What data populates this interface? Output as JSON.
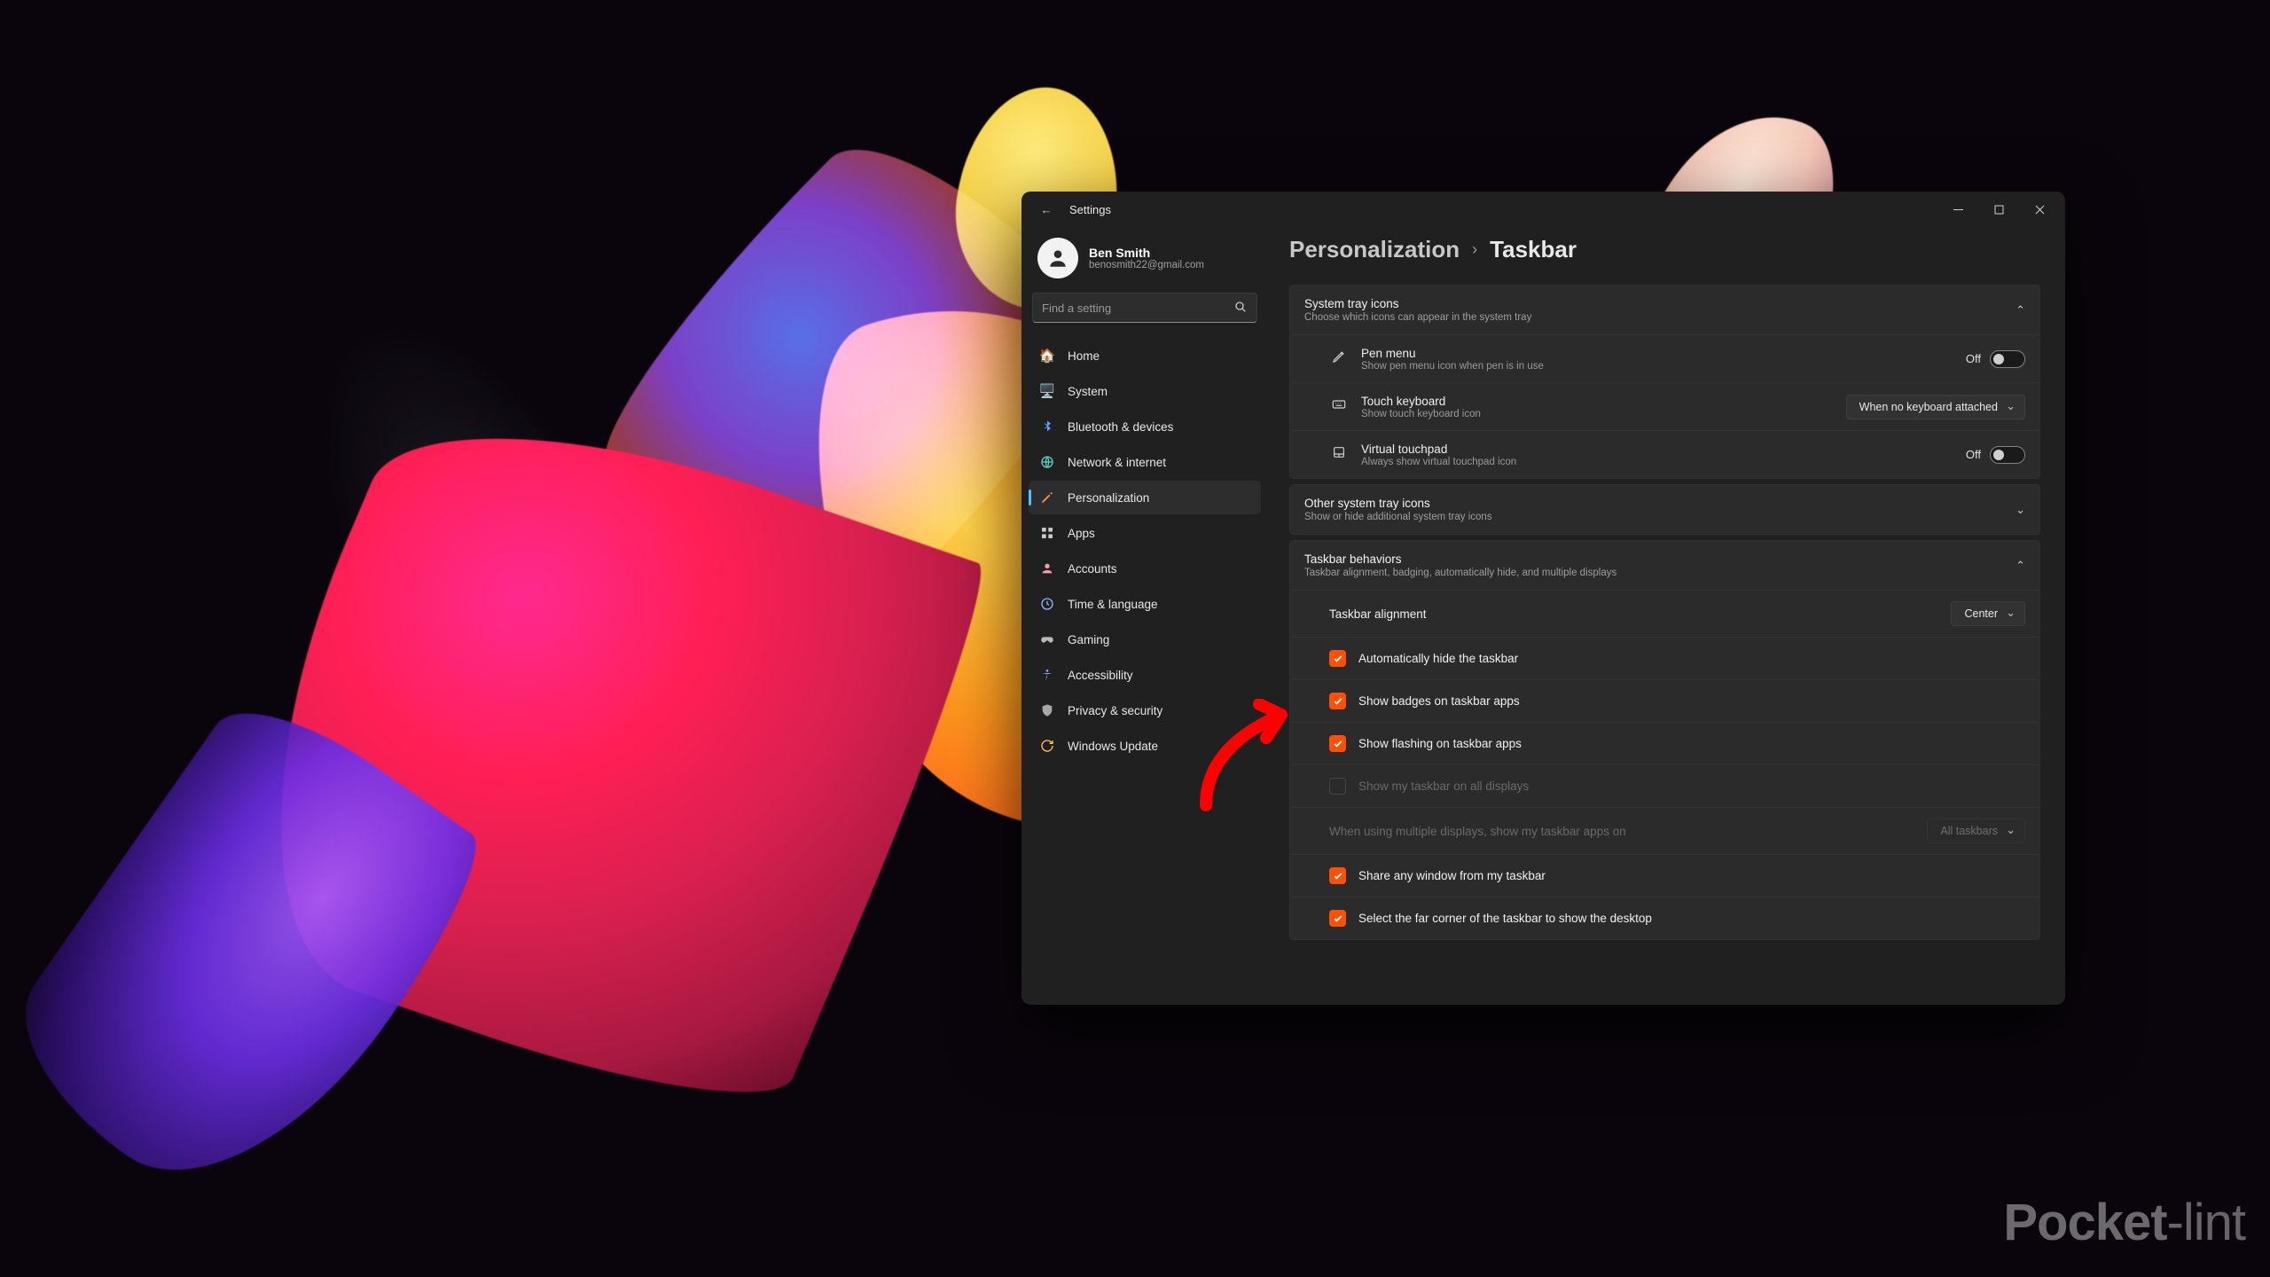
{
  "watermark": "Pocket-lint",
  "window": {
    "title": "Settings",
    "controls": {
      "minimize": "Minimize",
      "maximize": "Maximize",
      "close": "Close"
    }
  },
  "user": {
    "name": "Ben Smith",
    "email": "benosmith22@gmail.com"
  },
  "search": {
    "placeholder": "Find a setting"
  },
  "sidebar": {
    "items": [
      {
        "id": "home",
        "label": "Home"
      },
      {
        "id": "system",
        "label": "System"
      },
      {
        "id": "bluetooth",
        "label": "Bluetooth & devices"
      },
      {
        "id": "network",
        "label": "Network & internet"
      },
      {
        "id": "personalization",
        "label": "Personalization",
        "selected": true
      },
      {
        "id": "apps",
        "label": "Apps"
      },
      {
        "id": "accounts",
        "label": "Accounts"
      },
      {
        "id": "time",
        "label": "Time & language"
      },
      {
        "id": "gaming",
        "label": "Gaming"
      },
      {
        "id": "accessibility",
        "label": "Accessibility"
      },
      {
        "id": "privacy",
        "label": "Privacy & security"
      },
      {
        "id": "update",
        "label": "Windows Update"
      }
    ]
  },
  "breadcrumb": {
    "parent": "Personalization",
    "current": "Taskbar"
  },
  "sections": {
    "tray": {
      "title": "System tray icons",
      "sub": "Choose which icons can appear in the system tray",
      "items": {
        "pen": {
          "title": "Pen menu",
          "sub": "Show pen menu icon when pen is in use",
          "state": "Off"
        },
        "touch": {
          "title": "Touch keyboard",
          "sub": "Show touch keyboard icon",
          "state": "When no keyboard attached"
        },
        "vtp": {
          "title": "Virtual touchpad",
          "sub": "Always show virtual touchpad icon",
          "state": "Off"
        }
      }
    },
    "other": {
      "title": "Other system tray icons",
      "sub": "Show or hide additional system tray icons"
    },
    "behaviors": {
      "title": "Taskbar behaviors",
      "sub": "Taskbar alignment, badging, automatically hide, and multiple displays",
      "alignment": {
        "label": "Taskbar alignment",
        "value": "Center"
      },
      "checks": {
        "autohide": {
          "label": "Automatically hide the taskbar",
          "checked": true
        },
        "badges": {
          "label": "Show badges on taskbar apps",
          "checked": true
        },
        "flashing": {
          "label": "Show flashing on taskbar apps",
          "checked": true
        },
        "alldisp": {
          "label": "Show my taskbar on all displays",
          "checked": false,
          "disabled": true
        },
        "share": {
          "label": "Share any window from my taskbar",
          "checked": true
        },
        "farcorner": {
          "label": "Select the far corner of the taskbar to show the desktop",
          "checked": true
        }
      },
      "multi": {
        "label": "When using multiple displays, show my taskbar apps on",
        "value": "All taskbars",
        "disabled": true
      }
    }
  }
}
